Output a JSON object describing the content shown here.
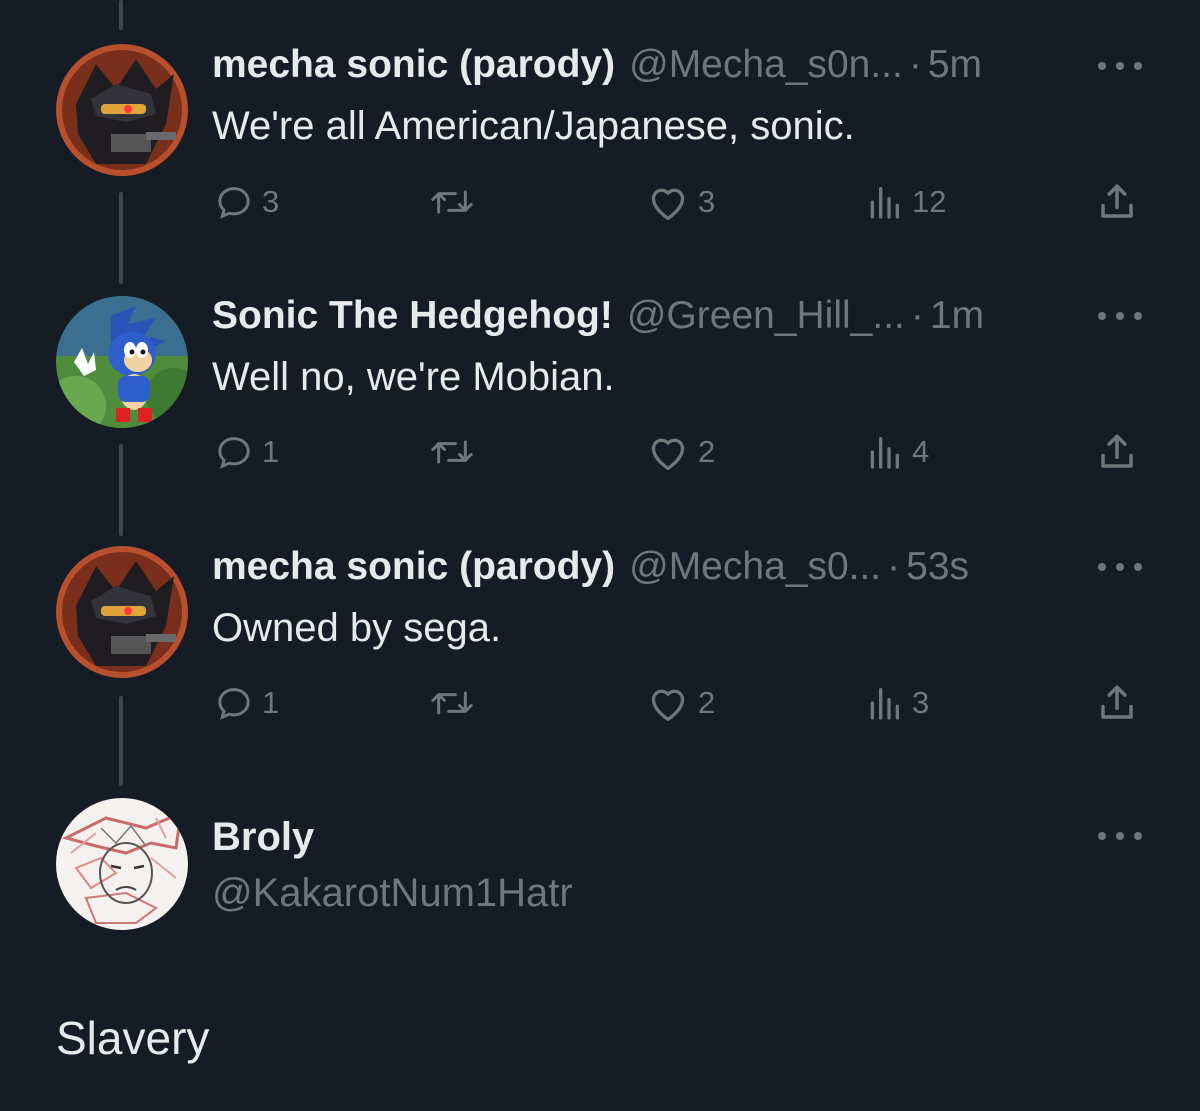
{
  "tweets": [
    {
      "display_name": "mecha sonic (parody)",
      "handle": "@Mecha_s0n...",
      "dot": "·",
      "time": "5m",
      "text": "We're all American/Japanese, sonic.",
      "replies": "3",
      "retweets": "",
      "likes": "3",
      "views": "12",
      "avatar": "mecha-sonic-avatar"
    },
    {
      "display_name": "Sonic The Hedgehog!",
      "handle": "@Green_Hill_...",
      "dot": "·",
      "time": "1m",
      "text": "Well no, we're Mobian.",
      "replies": "1",
      "retweets": "",
      "likes": "2",
      "views": "4",
      "avatar": "sonic-avatar"
    },
    {
      "display_name": "mecha sonic (parody)",
      "handle": "@Mecha_s0...",
      "dot": "·",
      "time": "53s",
      "text": "Owned by sega.",
      "replies": "1",
      "retweets": "",
      "likes": "2",
      "views": "3",
      "avatar": "mecha-sonic-avatar"
    }
  ],
  "focused": {
    "display_name": "Broly",
    "handle": "@KakarotNum1Hatr",
    "text": "Slavery",
    "avatar": "broly-avatar"
  },
  "colors": {
    "background": "#151c26",
    "text_primary": "#e7e9ea",
    "text_secondary": "#71767b",
    "thread_line": "#3e4853"
  }
}
